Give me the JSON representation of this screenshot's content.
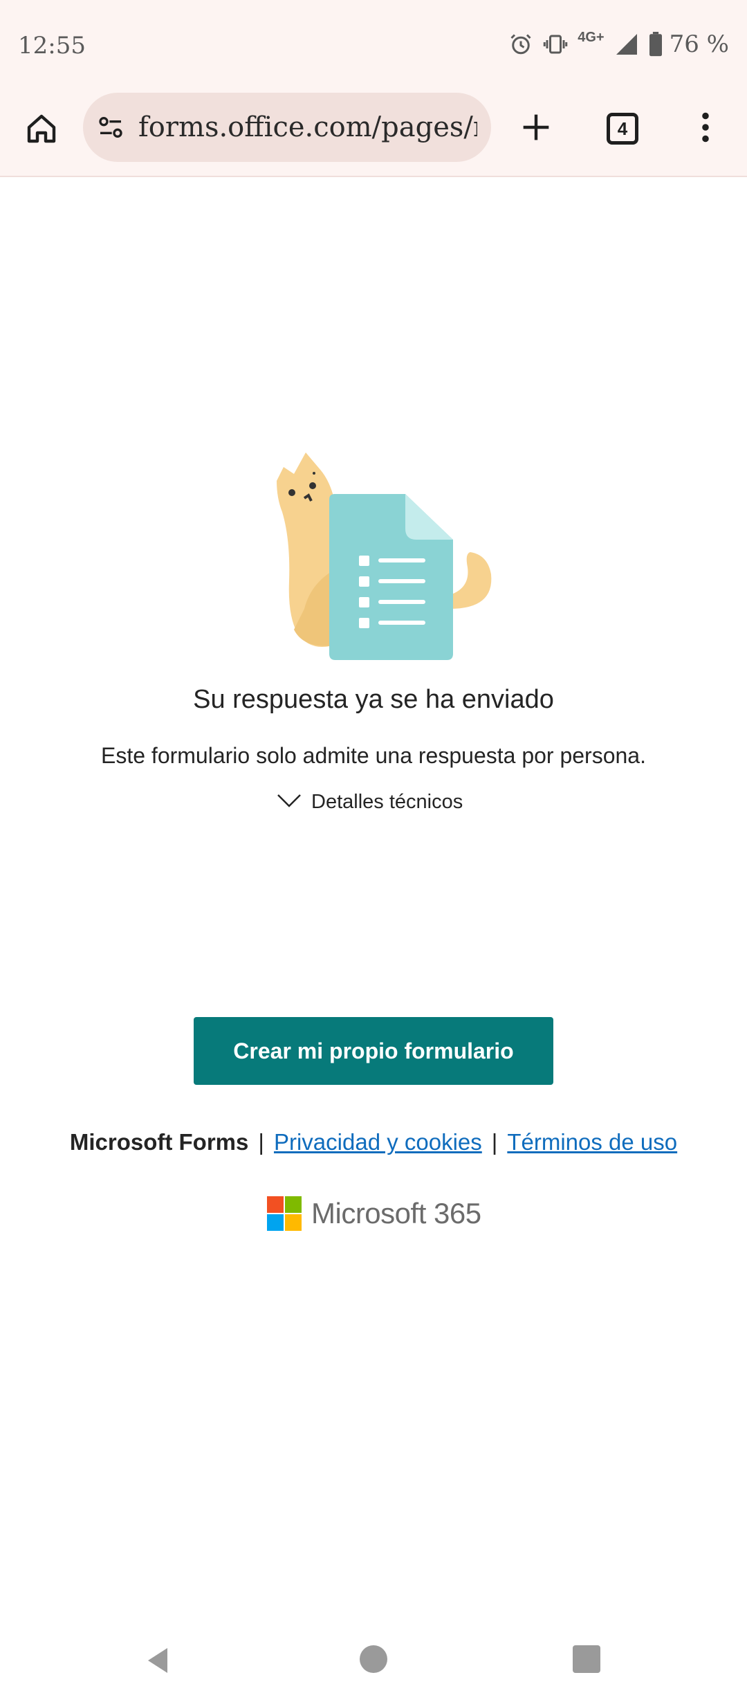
{
  "status_bar": {
    "time": "12:55",
    "network": "4G+",
    "battery": "76 %",
    "icons": [
      "alarm-icon",
      "vibrate-icon",
      "signal-icon",
      "battery-icon"
    ]
  },
  "browser": {
    "url": "forms.office.com/pages/re",
    "tab_count": "4",
    "icons": [
      "home-icon",
      "site-settings-icon",
      "plus-icon",
      "tabs-icon",
      "more-vert-icon"
    ]
  },
  "main": {
    "heading": "Su respuesta ya se ha enviado",
    "subtext": "Este formulario solo admite una respuesta por persona.",
    "tech_details": "Detalles técnicos",
    "create_button": "Crear mi propio formulario"
  },
  "footer": {
    "brand": "Microsoft Forms",
    "separator": "|",
    "privacy_link": "Privacidad y cookies",
    "terms_link": "Términos de uso",
    "ms365_label": "Microsoft 365"
  },
  "colors": {
    "accent": "#077a7a",
    "link": "#0f6cbd",
    "ms_red": "#f25022",
    "ms_green": "#7fba00",
    "ms_blue": "#00a4ef",
    "ms_yellow": "#ffb900"
  }
}
